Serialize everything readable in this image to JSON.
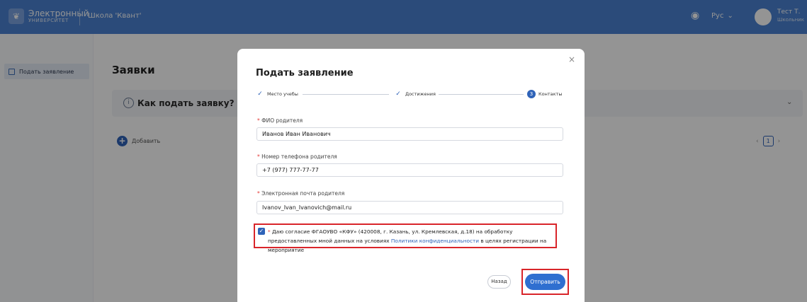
{
  "colors": {
    "brand": "#4a82d2",
    "accent": "#2f63b8",
    "highlight": "#d9252a"
  },
  "topbar": {
    "logo_line1": "Электронный",
    "logo_line2": "УНИВЕРСИТЕТ",
    "school": "Школа 'Квант'",
    "language": "Рус",
    "user_name": "Тест Т.",
    "user_role": "Школьник",
    "icons": {
      "logo": "university-logo",
      "eye": "eye-icon",
      "lang": "chevron-down-icon"
    }
  },
  "sidebar": {
    "items": [
      {
        "label": "Подать заявление",
        "icon": "document-icon"
      }
    ]
  },
  "main": {
    "title": "Заявки",
    "howto": "Как подать заявку?",
    "add_label": "Добавить",
    "pager": {
      "prev": "‹",
      "page": "1",
      "next": "›"
    }
  },
  "modal": {
    "title": "Подать заявление",
    "close": "×",
    "steps": [
      {
        "label": "Место учебы",
        "state": "done"
      },
      {
        "label": "Достижения",
        "state": "done"
      },
      {
        "label": "Контакты",
        "state": "active",
        "number": "3"
      }
    ],
    "fields": {
      "parent_name": {
        "label": "ФИО родителя",
        "value": "Иванов Иван Иванович"
      },
      "parent_phone": {
        "label": "Номер телефона родителя",
        "value": "+7 (977) 777-77-77"
      },
      "parent_email": {
        "label": "Электронная почта родителя",
        "value": "Ivanov_Ivan_Ivanovich@mail.ru"
      }
    },
    "required_mark": "*",
    "consent": {
      "checked": true,
      "text_before": "Даю согласие ФГАОУВО «КФУ» (420008, г. Казань, ул. Кремлевская, д.18) на обработку предоставленных мной данных на условиях ",
      "link": "Политики конфиденциальности",
      "text_after": " в целях регистрации на мероприятие"
    },
    "back_label": "Назад",
    "submit_label": "Отправить"
  }
}
